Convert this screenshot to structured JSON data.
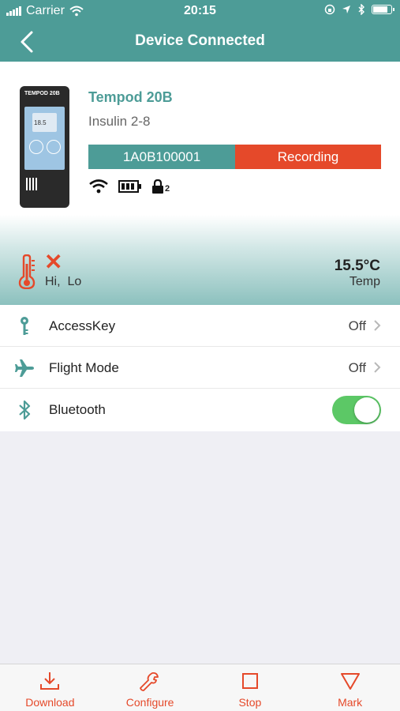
{
  "status_bar": {
    "carrier": "Carrier",
    "time": "20:15"
  },
  "nav": {
    "title": "Device Connected"
  },
  "device": {
    "name": "Tempod 20B",
    "profile": "Insulin 2-8",
    "serial": "1A0B100001",
    "state": "Recording",
    "lock_count": "2",
    "image_brand": "TEMPOD 20B",
    "image_reading": "18.5"
  },
  "temperature": {
    "alarm_labels": "Hi,  Lo",
    "value": "15.5°C",
    "label": "Temp"
  },
  "settings": [
    {
      "icon": "key-icon",
      "label": "AccessKey",
      "value": "Off"
    },
    {
      "icon": "airplane-icon",
      "label": "Flight Mode",
      "value": "Off"
    },
    {
      "icon": "bluetooth-icon",
      "label": "Bluetooth",
      "toggle_on": true
    }
  ],
  "tabs": [
    {
      "icon": "download-icon",
      "label": "Download"
    },
    {
      "icon": "wrench-icon",
      "label": "Configure"
    },
    {
      "icon": "stop-icon",
      "label": "Stop"
    },
    {
      "icon": "mark-triangle-icon",
      "label": "Mark"
    }
  ],
  "colors": {
    "primary": "#4d9c97",
    "accent": "#e5492a",
    "toggle_on": "#5cc866",
    "background": "#efeff4"
  }
}
